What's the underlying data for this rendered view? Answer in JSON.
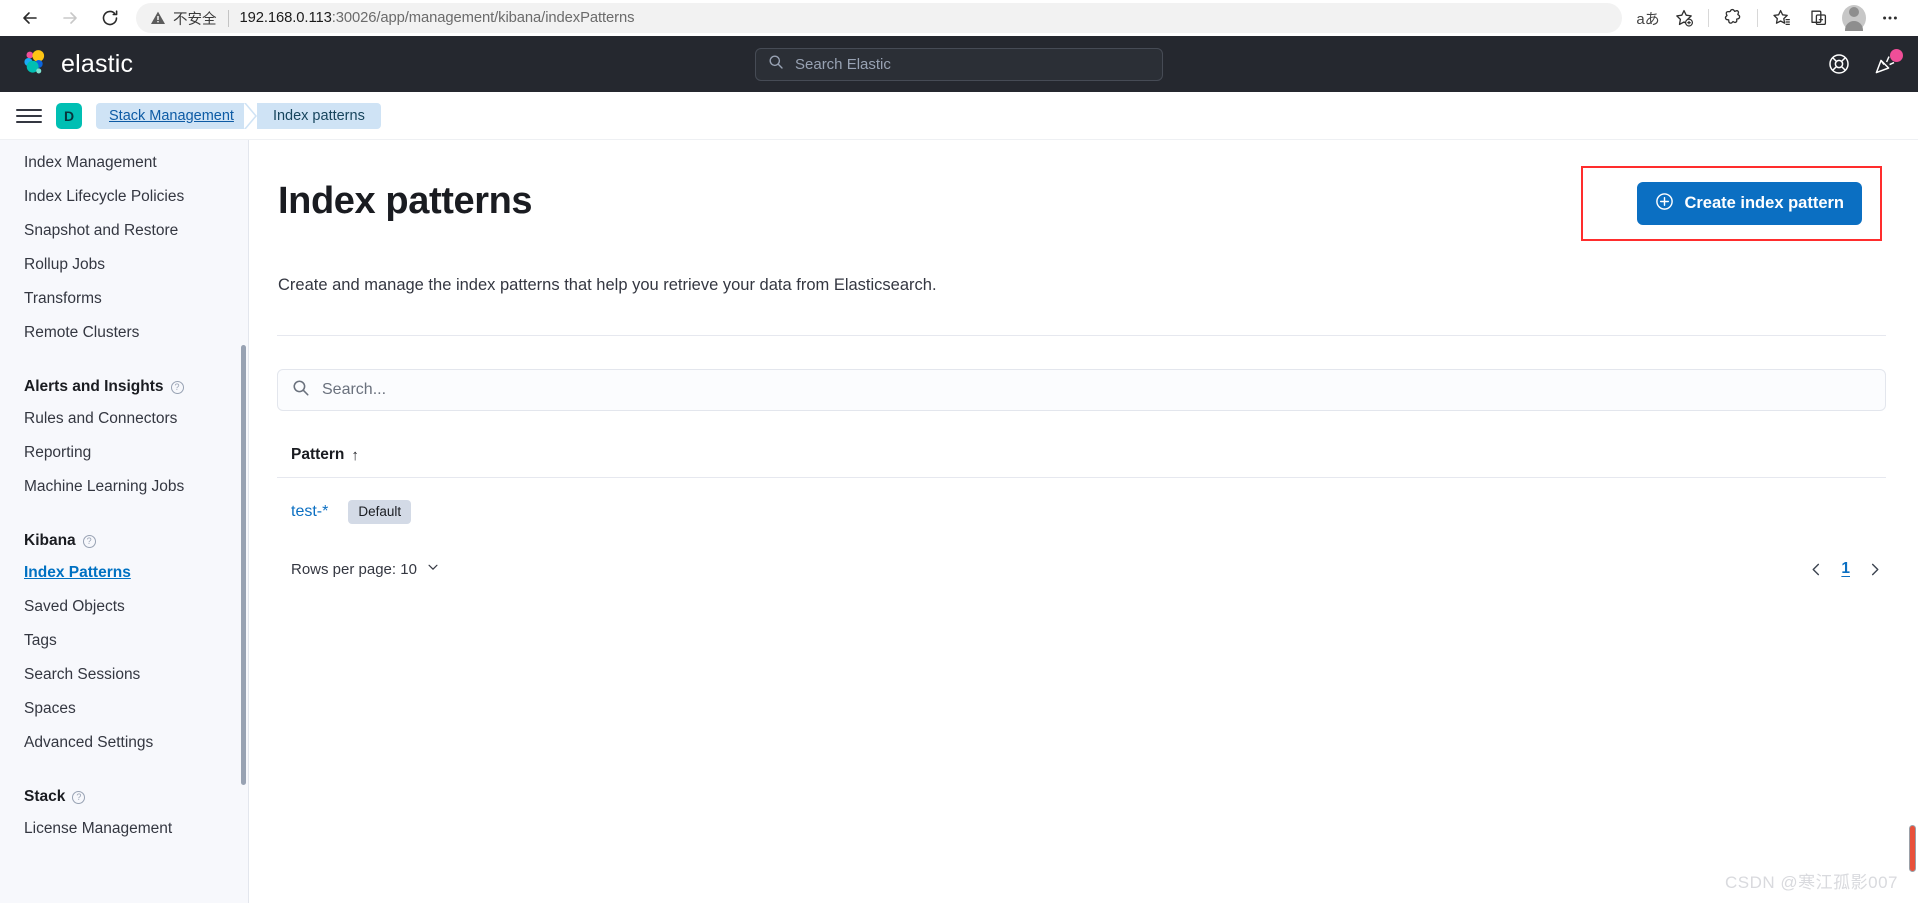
{
  "browser": {
    "back_label": "back-arrow",
    "forward_label": "forward-arrow",
    "reload_label": "reload",
    "security_text": "不安全",
    "url_host": "192.168.0.113",
    "url_rest": ":30026/app/management/kibana/indexPatterns",
    "icons": {
      "translate": "aあ",
      "add_favorite": "add-favorite-icon",
      "extensions": "extensions-icon",
      "favorites": "favorites-icon",
      "collections": "collections-icon",
      "profile": "profile-avatar",
      "settings": "settings-more-icon"
    }
  },
  "header": {
    "brand": "elastic",
    "search_placeholder": "Search Elastic",
    "help_icon": "help-lifebuoy-icon",
    "news_icon": "news-announcement-icon"
  },
  "breadcrumb": {
    "space_initial": "D",
    "items": [
      {
        "label": "Stack Management",
        "active": false
      },
      {
        "label": "Index patterns",
        "active": true
      }
    ]
  },
  "sidebar": {
    "items": [
      {
        "label": "Index Management",
        "active": false
      },
      {
        "label": "Index Lifecycle Policies",
        "active": false
      },
      {
        "label": "Snapshot and Restore",
        "active": false
      },
      {
        "label": "Rollup Jobs",
        "active": false
      },
      {
        "label": "Transforms",
        "active": false
      },
      {
        "label": "Remote Clusters",
        "active": false
      }
    ],
    "group_alerts": {
      "title": "Alerts and Insights",
      "items": [
        {
          "label": "Rules and Connectors",
          "active": false
        },
        {
          "label": "Reporting",
          "active": false
        },
        {
          "label": "Machine Learning Jobs",
          "active": false
        }
      ]
    },
    "group_kibana": {
      "title": "Kibana",
      "items": [
        {
          "label": "Index Patterns",
          "active": true
        },
        {
          "label": "Saved Objects",
          "active": false
        },
        {
          "label": "Tags",
          "active": false
        },
        {
          "label": "Search Sessions",
          "active": false
        },
        {
          "label": "Spaces",
          "active": false
        },
        {
          "label": "Advanced Settings",
          "active": false
        }
      ]
    },
    "group_stack": {
      "title": "Stack",
      "items": [
        {
          "label": "License Management",
          "active": false
        }
      ]
    }
  },
  "main": {
    "title": "Index patterns",
    "create_button": "Create index pattern",
    "description": "Create and manage the index patterns that help you retrieve your data from Elasticsearch.",
    "search_placeholder": "Search...",
    "table": {
      "columns": [
        {
          "label": "Pattern",
          "sort": "↑"
        }
      ],
      "rows": [
        {
          "pattern": "test-*",
          "badge": "Default"
        }
      ]
    },
    "footer": {
      "rows_per_page_label": "Rows per page: 10",
      "page_current": "1"
    }
  },
  "watermark": "CSDN @寒江孤影007",
  "colors": {
    "accent_blue": "#0b6fc2",
    "header_dark": "#25282f",
    "space_teal": "#00bfb3",
    "annotation_red": "#ff2d2d",
    "badge_gray": "#d3dae6",
    "news_pink": "#f04e98"
  }
}
